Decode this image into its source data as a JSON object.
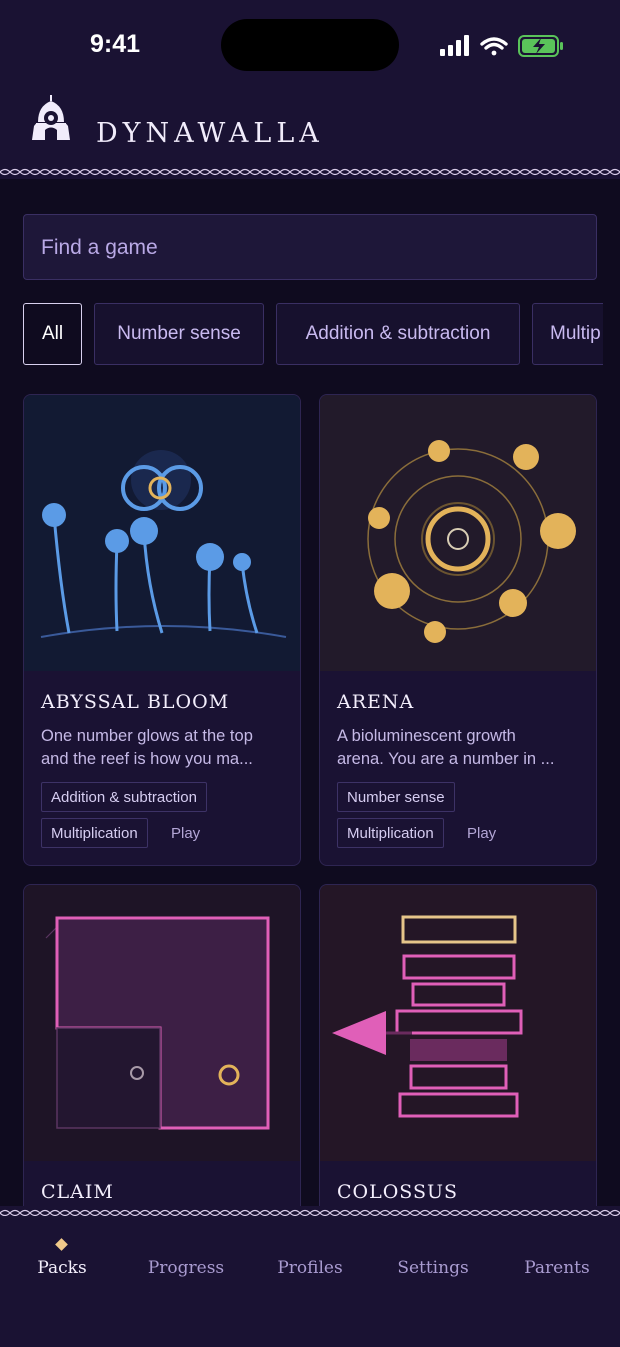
{
  "status": {
    "time": "9:41"
  },
  "app": {
    "brand": "DYNAWALLA"
  },
  "search": {
    "placeholder": "Find a game"
  },
  "filters": [
    {
      "label": "All",
      "active": true
    },
    {
      "label": "Number sense",
      "active": false
    },
    {
      "label": "Addition & subtraction",
      "active": false
    },
    {
      "label": "Multip",
      "active": false
    }
  ],
  "games": [
    {
      "title": "ABYSSAL BLOOM",
      "desc_line1": "One number glows at the top",
      "desc_line2": "and the reef is how you ma...",
      "tags": [
        "Addition & subtraction",
        "Multiplication"
      ],
      "play": "Play"
    },
    {
      "title": "ARENA",
      "desc_line1": "A bioluminescent growth",
      "desc_line2": "arena. You are a number in ...",
      "tags": [
        "Number sense",
        "Multiplication"
      ],
      "play": "Play"
    },
    {
      "title": "CLAIM"
    },
    {
      "title": "COLOSSUS"
    }
  ],
  "tabs": [
    {
      "label": "Packs",
      "active": true
    },
    {
      "label": "Progress",
      "active": false
    },
    {
      "label": "Profiles",
      "active": false
    },
    {
      "label": "Settings",
      "active": false
    },
    {
      "label": "Parents",
      "active": false
    }
  ],
  "colors": {
    "background": "#0f0b1f",
    "surface": "#1a1233",
    "accent_blue": "#5b9be6",
    "accent_gold": "#e3b35a",
    "accent_pink": "#e05fb8"
  },
  "icons": [
    "signal-icon",
    "wifi-icon",
    "battery-charging-icon",
    "temple-logo-icon"
  ]
}
